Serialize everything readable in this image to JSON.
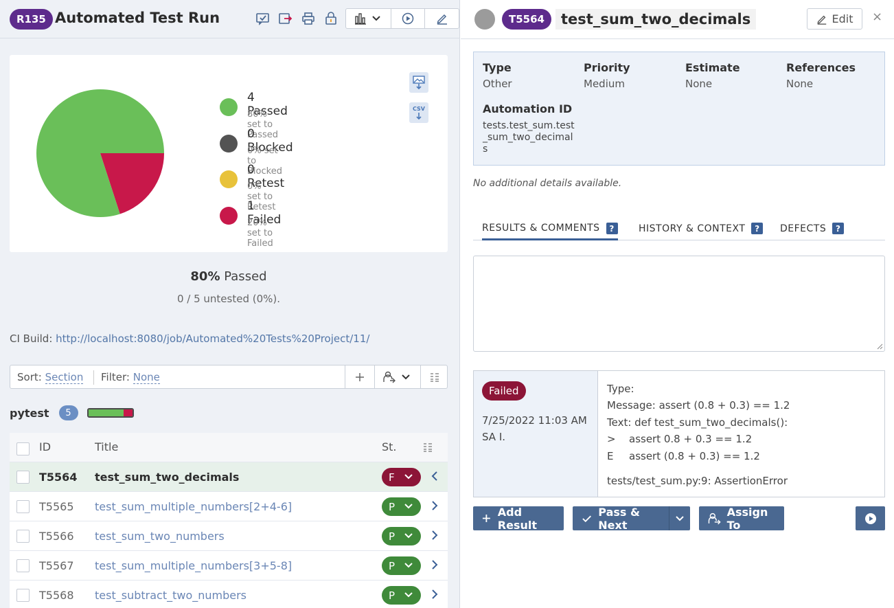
{
  "run": {
    "id": "R135",
    "title": "Automated Test Run"
  },
  "stats": {
    "legend": [
      {
        "label": "4 Passed",
        "sub": "80% set to Passed",
        "color": "#6abf59"
      },
      {
        "label": "0 Blocked",
        "sub": "0% set to Blocked",
        "color": "#535353"
      },
      {
        "label": "0 Retest",
        "sub": "0% set to Retest",
        "color": "#e8c23a"
      },
      {
        "label": "1 Failed",
        "sub": "20% set to Failed",
        "color": "#c8184a"
      }
    ],
    "export_csv_label": "CSV",
    "passed_pct": "80%",
    "passed_word": "Passed",
    "untested": "0 / 5 untested (0%)."
  },
  "chart_data": {
    "type": "pie",
    "categories": [
      "Passed",
      "Blocked",
      "Retest",
      "Failed"
    ],
    "values": [
      4,
      0,
      0,
      1
    ],
    "colors": [
      "#6abf59",
      "#535353",
      "#e8c23a",
      "#c8184a"
    ]
  },
  "ci": {
    "label": "CI Build:",
    "url": "http://localhost:8080/job/Automated%20Tests%20Project/11/"
  },
  "sortbar": {
    "sort_label": "Sort:",
    "sort_value": "Section",
    "filter_label": "Filter:",
    "filter_value": "None"
  },
  "group": {
    "name": "pytest",
    "count": "5",
    "passed_fraction": 0.8
  },
  "table": {
    "headers": {
      "id": "ID",
      "title": "Title",
      "status": "St."
    },
    "rows": [
      {
        "id": "T5564",
        "title": "test_sum_two_decimals",
        "status": "F",
        "color": "#8c1537"
      },
      {
        "id": "T5565",
        "title": "test_sum_multiple_numbers[2+4-6]",
        "status": "P",
        "color": "#3f8a3a"
      },
      {
        "id": "T5566",
        "title": "test_sum_two_numbers",
        "status": "P",
        "color": "#3f8a3a"
      },
      {
        "id": "T5567",
        "title": "test_sum_multiple_numbers[3+5-8]",
        "status": "P",
        "color": "#3f8a3a"
      },
      {
        "id": "T5568",
        "title": "test_subtract_two_numbers",
        "status": "P",
        "color": "#3f8a3a"
      }
    ]
  },
  "test": {
    "id": "T5564",
    "title": "test_sum_two_decimals",
    "edit_label": "Edit",
    "close": "×",
    "type_label": "Type",
    "type_value": "Other",
    "priority_label": "Priority",
    "priority_value": "Medium",
    "estimate_label": "Estimate",
    "estimate_value": "None",
    "references_label": "References",
    "references_value": "None",
    "automation_label": "Automation ID",
    "automation_value": "tests.test_sum.test_sum_two_decimals",
    "no_details": "No additional details available."
  },
  "tabs": {
    "results": "RESULTS & COMMENTS",
    "history": "HISTORY & CONTEXT",
    "defects": "DEFECTS",
    "help": "?"
  },
  "result": {
    "status": "Failed",
    "date": "7/25/2022 11:03 AM",
    "user": "SA I.",
    "line1": "Type:",
    "line2": "Message: assert (0.8 + 0.3) == 1.2",
    "line3": "Text: def test_sum_two_decimals():",
    "line4_prefix": ">",
    "line4": "assert 0.8 + 0.3 == 1.2",
    "line5_prefix": "E",
    "line5": "assert (0.8 + 0.3) == 1.2",
    "path": "tests/test_sum.py:9: AssertionError"
  },
  "actions": {
    "add_result": "Add Result",
    "pass_next": "Pass & Next",
    "assign_to": "Assign To"
  }
}
